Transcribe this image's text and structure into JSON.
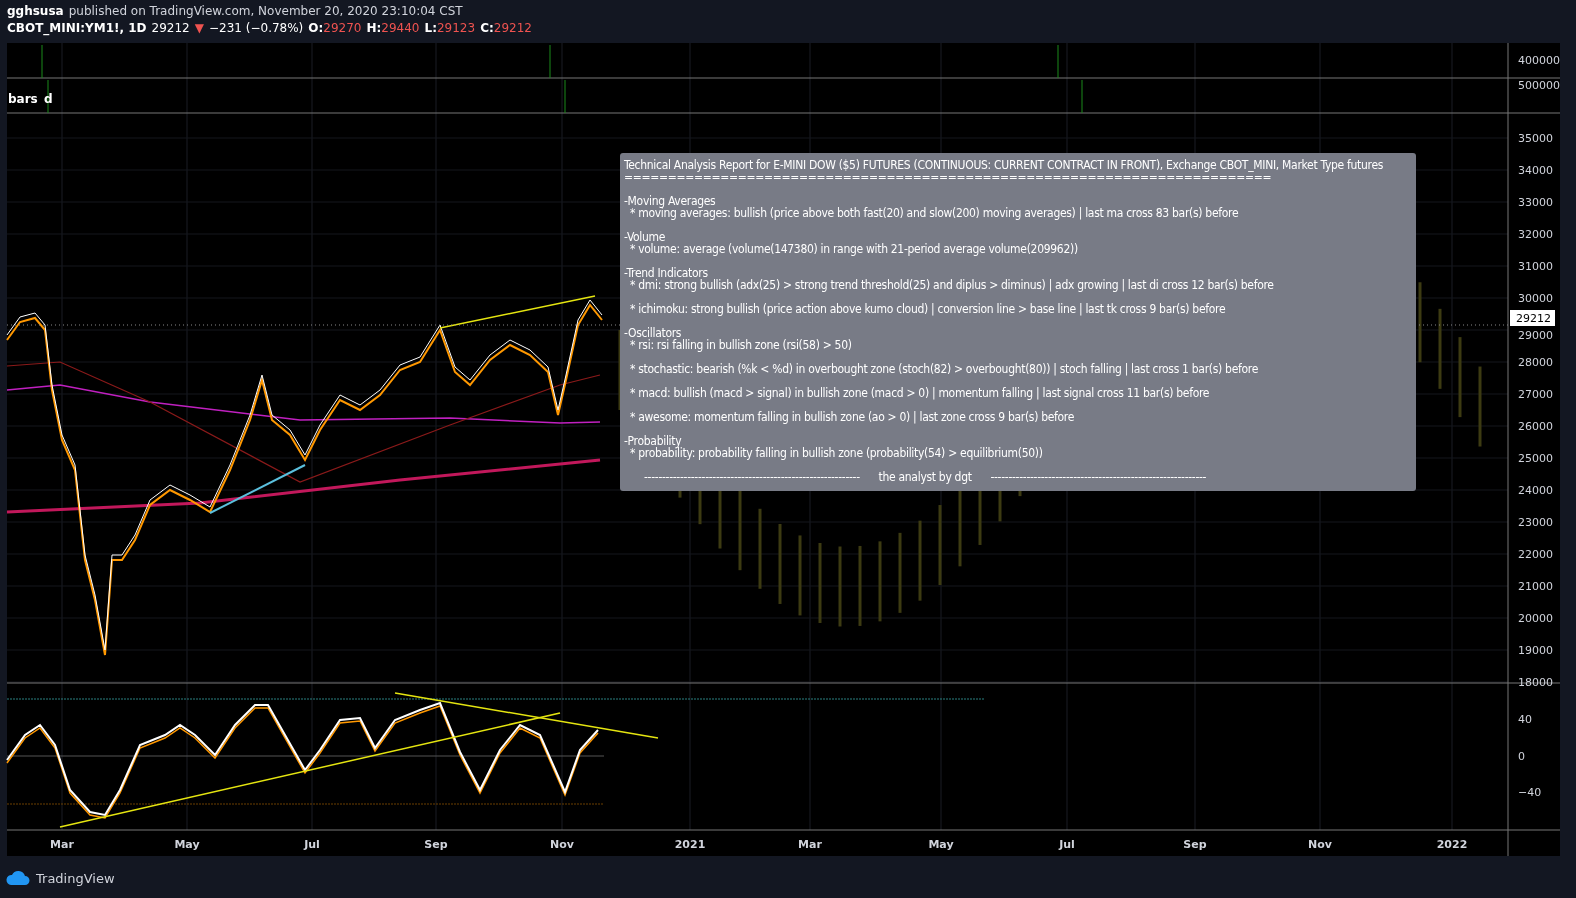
{
  "header": {
    "author": "gghsusa",
    "published": "published on TradingView.com, November 20, 2020 23:10:04 CST",
    "symbol": "CBOT_MINI:YM1!, 1D",
    "last": "29212",
    "direction_symbol": "▼",
    "change": "−231 (−0.78%)",
    "ohlc": [
      {
        "label": "O:",
        "value": "29270"
      },
      {
        "label": "H:",
        "value": "29440"
      },
      {
        "label": "L:",
        "value": "29123"
      },
      {
        "label": "C:",
        "value": "29212"
      }
    ]
  },
  "volume_panes": [
    {
      "axis_label": "400000"
    },
    {
      "axis_label": "500000",
      "legend": [
        "bars",
        "d"
      ]
    }
  ],
  "price_axis": [
    "35000",
    "34000",
    "33000",
    "32000",
    "31000",
    "30000",
    "29000",
    "28000",
    "27000",
    "26000",
    "25000",
    "24000",
    "23000",
    "22000",
    "21000",
    "20000",
    "19000",
    "18000"
  ],
  "current_price": "29212",
  "oscillator_axis": [
    "40",
    "0",
    "−40"
  ],
  "time_axis": [
    "Mar",
    "May",
    "Jul",
    "Sep",
    "Nov",
    "2021",
    "Mar",
    "May",
    "Jul",
    "Sep",
    "Nov",
    "2022"
  ],
  "report": {
    "title": "Technical Analysis Report for E-MINI DOW ($5) FUTURES (CONTINUOUS: CURRENT CONTRACT IN FRONT), Exchange CBOT_MINI, Market Type futures",
    "rule": "==========================================================================",
    "sections": [
      {
        "heading": "-Moving Averages",
        "items": [
          "* moving averages: bullish (price above both fast(20) and slow(200) moving averages) | last ma cross 83 bar(s) before"
        ]
      },
      {
        "heading": "-Volume",
        "items": [
          "* volume: average (volume(147380) in range with 21-period average volume(209962))"
        ]
      },
      {
        "heading": "-Trend Indicators",
        "items": [
          "* dmi: strong bullish (adx(25) > strong trend threshold(25) and diplus > diminus) | adx growing | last di cross 12 bar(s) before",
          "* ichimoku: strong bullish (price action above kumo cloud) | conversion line > base line | last tk cross 9 bar(s) before"
        ]
      },
      {
        "heading": "-Oscillators",
        "items": [
          "* rsi: rsi falling in bullish zone (rsi(58) > 50)",
          "* stochastic: bearish (%k < %d) in overbought zone (stoch(82) > overbought(80)) | stoch falling | last cross 1 bar(s) before",
          "* macd: bullish (macd > signal) in bullish zone (macd > 0) | momentum falling | last signal cross 11 bar(s) before",
          "* awesome: momentum falling in bullish zone (ao > 0) | last zone cross 9 bar(s) before"
        ]
      },
      {
        "heading": "-Probability",
        "items": [
          "* probability: probability falling in bullish zone (probability(54) > equilibrium(50))"
        ]
      }
    ],
    "signature": "------------------------------------------------------------      the analyst by dgt      ------------------------------------------------------------"
  },
  "footer": {
    "brand": "TradingView"
  }
}
